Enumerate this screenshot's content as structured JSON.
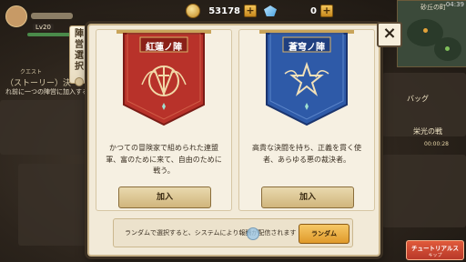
{
  "status_bar": {
    "time": "04:39"
  },
  "minimap": {
    "location_name": "砂丘の町"
  },
  "player": {
    "level": "Lv20"
  },
  "currency": {
    "gold": {
      "value": "53178",
      "icon": "coin-icon"
    },
    "gems": {
      "value": "0",
      "icon": "gem-icon"
    }
  },
  "hud": {
    "quest_label": "クエスト",
    "story_label": "（ストーリー）決",
    "story_sub": "れ前に一つの陣営に加入する",
    "bag_label": "バッグ",
    "glory_label": "栄光の戦",
    "glory_time": "00:00:28",
    "tutorial": {
      "title": "チュートリアルス",
      "sub": "キップ"
    }
  },
  "dialog": {
    "side_tab": "陣営選択",
    "close_label": "×",
    "factions": [
      {
        "name": "紅蓮ノ陣",
        "color": "#b8322a",
        "desc": "かつての冒険家で組められた連盟軍、富のために来て、自由のために戦う。",
        "join_label": "加入"
      },
      {
        "name": "蒼穹ノ陣",
        "color": "#2e5aa8",
        "desc": "高貴な決闘を持ち、正義を貫く使者、あらゆる悪の裁決者。",
        "join_label": "加入"
      }
    ],
    "random_text": "ランダムで選択すると、システムにより報酬が配信されます",
    "random_button": "ランダム"
  }
}
